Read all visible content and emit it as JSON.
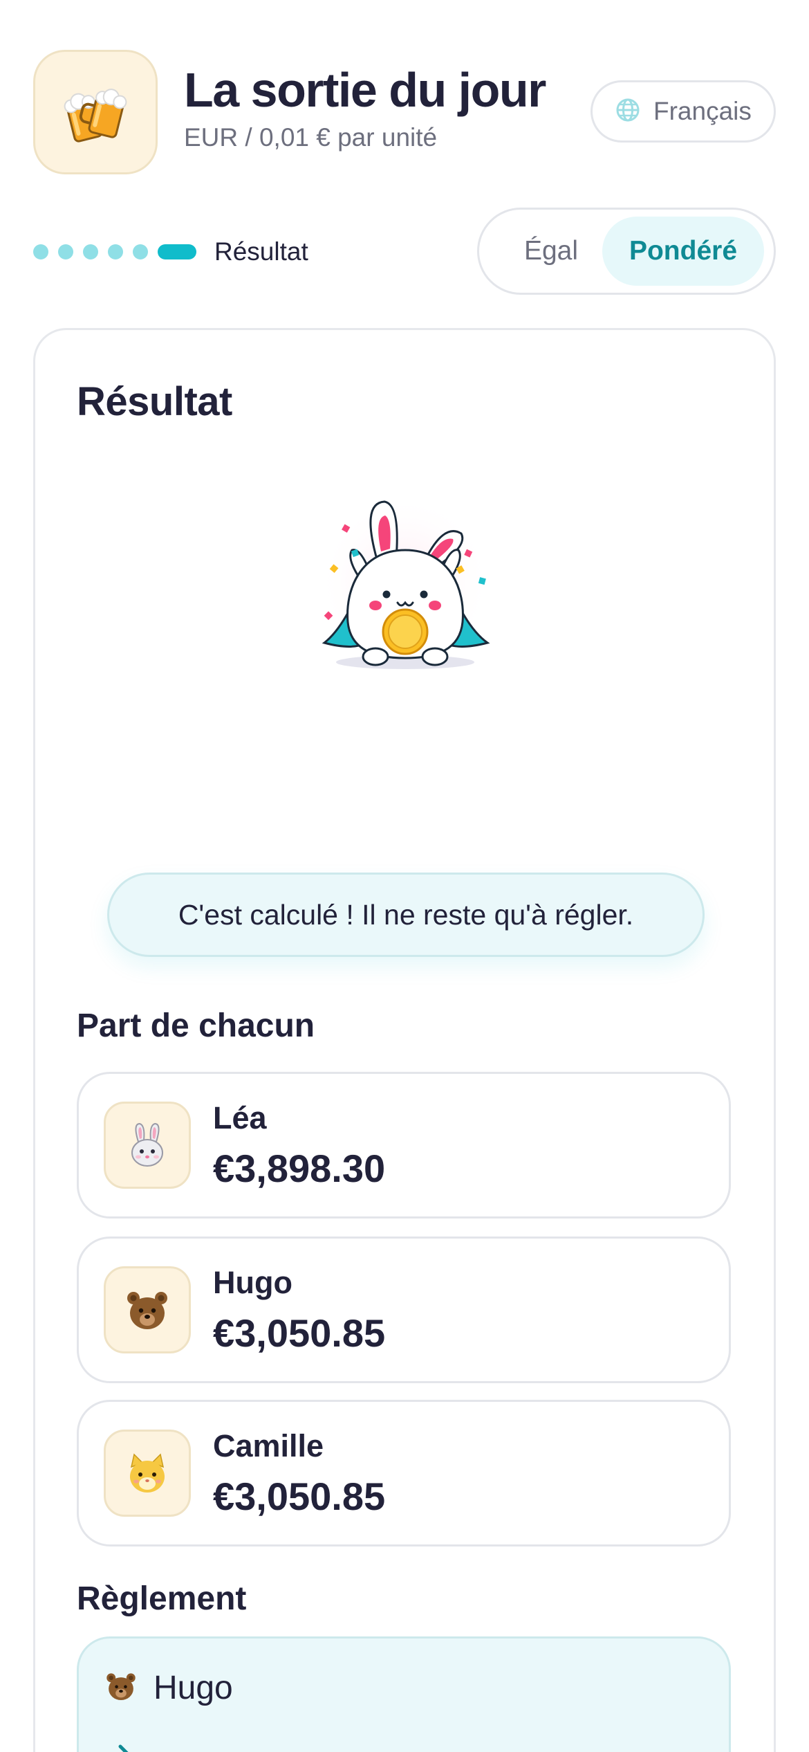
{
  "header": {
    "title": "La sortie du jour",
    "subtitle": "EUR / 0,01 € par unité",
    "language": "Français",
    "app_icon": "beer-mugs-icon"
  },
  "steps": {
    "label": "Résultat",
    "total": 6,
    "current": 6
  },
  "split_mode": {
    "options": [
      "Égal",
      "Pondéré"
    ],
    "selected": "Pondéré"
  },
  "result": {
    "title": "Résultat",
    "illustration": "celebrating-bunny-with-coin",
    "message": "C'est calculé ! Il ne reste qu'à régler."
  },
  "shares": {
    "title": "Part de chacun",
    "items": [
      {
        "name": "Léa",
        "amount": "€3,898.30",
        "avatar": "rabbit-icon"
      },
      {
        "name": "Hugo",
        "amount": "€3,050.85",
        "avatar": "bear-icon"
      },
      {
        "name": "Camille",
        "amount": "€3,050.85",
        "avatar": "hamster-icon"
      }
    ]
  },
  "settlement": {
    "title": "Règlement",
    "from": "Hugo",
    "from_avatar": "bear-icon"
  },
  "colors": {
    "accent": "#10bccb",
    "accent_light": "#e6f8fa",
    "text": "#22223a",
    "muted": "#6d6f7e",
    "avatar_bg": "#fdf3df"
  }
}
